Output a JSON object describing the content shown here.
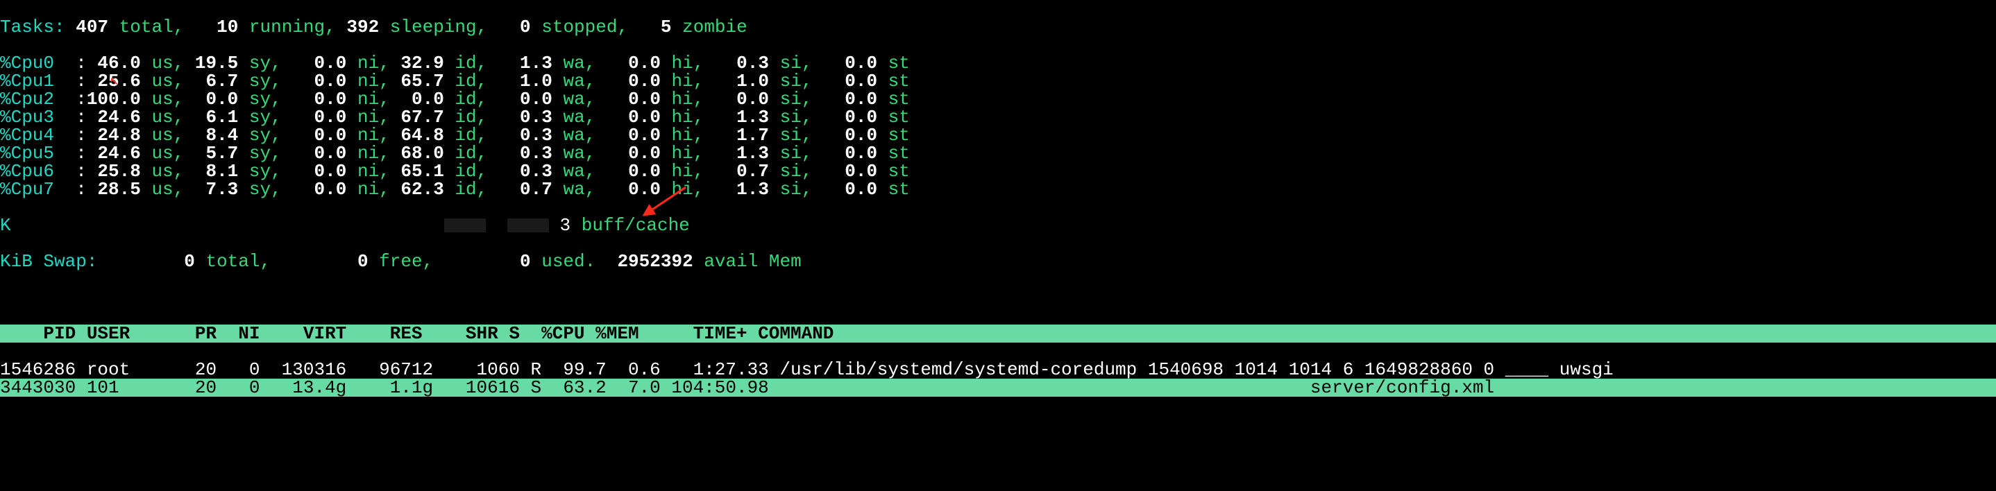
{
  "tasks": {
    "label": "Tasks:",
    "total_v": "407",
    "total_l": "total,",
    "run_v": "10",
    "run_l": "running,",
    "slp_v": "392",
    "slp_l": "sleeping,",
    "stp_v": "0",
    "stp_l": "stopped,",
    "zmb_v": "5",
    "zmb_l": "zombie"
  },
  "cpus": [
    {
      "name": "%Cpu0",
      "sep": "  :",
      "us": " 46.0",
      "sy": "19.5",
      "ni": " 0.0",
      "id": "32.9",
      "wa": " 1.3",
      "hi": " 0.0",
      "si": " 0.3",
      "st": " 0.0"
    },
    {
      "name": "%Cpu1",
      "sep": "  :",
      "us": " 25.6",
      "sy": " 6.7",
      "ni": " 0.0",
      "id": "65.7",
      "wa": " 1.0",
      "hi": " 0.0",
      "si": " 1.0",
      "st": " 0.0"
    },
    {
      "name": "%Cpu2",
      "sep": "  :",
      "us": "100.0",
      "sy": " 0.0",
      "ni": " 0.0",
      "id": " 0.0",
      "wa": " 0.0",
      "hi": " 0.0",
      "si": " 0.0",
      "st": " 0.0"
    },
    {
      "name": "%Cpu3",
      "sep": "  :",
      "us": " 24.6",
      "sy": " 6.1",
      "ni": " 0.0",
      "id": "67.7",
      "wa": " 0.3",
      "hi": " 0.0",
      "si": " 1.3",
      "st": " 0.0"
    },
    {
      "name": "%Cpu4",
      "sep": "  :",
      "us": " 24.8",
      "sy": " 8.4",
      "ni": " 0.0",
      "id": "64.8",
      "wa": " 0.3",
      "hi": " 0.0",
      "si": " 1.7",
      "st": " 0.0"
    },
    {
      "name": "%Cpu5",
      "sep": "  :",
      "us": " 24.6",
      "sy": " 5.7",
      "ni": " 0.0",
      "id": "68.0",
      "wa": " 0.3",
      "hi": " 0.0",
      "si": " 1.3",
      "st": " 0.0"
    },
    {
      "name": "%Cpu6",
      "sep": "  :",
      "us": " 25.8",
      "sy": " 8.1",
      "ni": " 0.0",
      "id": "65.1",
      "wa": " 0.3",
      "hi": " 0.0",
      "si": " 0.7",
      "st": " 0.0"
    },
    {
      "name": "%Cpu7",
      "sep": "  :",
      "us": " 28.5",
      "sy": " 7.3",
      "ni": " 0.0",
      "id": "62.3",
      "wa": " 0.7",
      "hi": " 0.0",
      "si": " 1.3",
      "st": " 0.0"
    }
  ],
  "cpu_labels": {
    "us": "us,",
    "sy": "sy,",
    "ni": "ni,",
    "id": "id,",
    "wa": "wa,",
    "hi": "hi,",
    "si": "si,",
    "st": "st"
  },
  "mem_truncated": {
    "prefix": "K",
    "suffix_label": "buff/cache"
  },
  "swap": {
    "label": "KiB Swap:",
    "total_v": "0",
    "total_l": "total,",
    "free_v": "0",
    "free_l": "free,",
    "used_v": "0",
    "used_l": "used.",
    "avail_v": "2952392",
    "avail_l": "avail Mem"
  },
  "header": "    PID USER      PR  NI    VIRT    RES    SHR S  %CPU %MEM     TIME+ COMMAND",
  "procs": [
    {
      "pid": "1546286",
      "user": "root",
      "pr": "20",
      "ni": "0",
      "virt": "130316",
      "res": "96712",
      "shr": "1060",
      "s": "R",
      "cpu": "99.7",
      "mem": "0.6",
      "time": "1:27.33",
      "cmd": "/usr/lib/systemd/systemd-coredump 1540698 1014 1014 6 1649828860 0 ____ uwsgi"
    },
    {
      "pid": "3443030",
      "user": "101",
      "pr": "20",
      "ni": "0",
      "virt": "13.4g",
      "res": "1.1g",
      "shr": "10616",
      "s": "S",
      "cpu": "63.2",
      "mem": "7.0",
      "time": "104:50.98",
      "cmd": "                                                 server/config.xml"
    }
  ]
}
